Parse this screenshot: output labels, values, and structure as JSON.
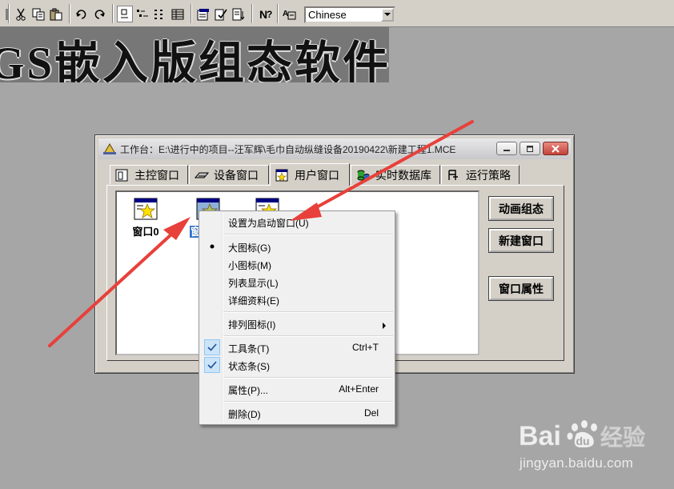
{
  "toolbar": {
    "language": "Chinese"
  },
  "banner": {
    "text": "GS嵌入版组态软件"
  },
  "workbench": {
    "title": "工作台：E:\\进行中的项目--汪军辉\\毛巾自动纵缝设备20190422\\新建工程1.MCE",
    "tabs": [
      {
        "label": "主控窗口",
        "icon": "main-window-icon"
      },
      {
        "label": "设备窗口",
        "icon": "device-icon"
      },
      {
        "label": "用户窗口",
        "icon": "user-window-icon",
        "active": true
      },
      {
        "label": "实时数据库",
        "icon": "database-icon"
      },
      {
        "label": "运行策略",
        "icon": "strategy-icon"
      }
    ],
    "items": [
      {
        "label": "窗口0"
      },
      {
        "label": "窗"
      },
      {
        "label": ""
      }
    ],
    "buttons": {
      "animation": "动画组态",
      "new_window": "新建窗口",
      "properties": "窗口属性"
    }
  },
  "context_menu": {
    "items": [
      {
        "label": "设置为启动窗口(U)",
        "shortcut": ""
      },
      {
        "label": "大图标(G)",
        "shortcut": "",
        "bullet": true
      },
      {
        "label": "小图标(M)",
        "shortcut": ""
      },
      {
        "label": "列表显示(L)",
        "shortcut": ""
      },
      {
        "label": "详细资料(E)",
        "shortcut": ""
      },
      {
        "label": "排列图标(I)",
        "shortcut": "",
        "submenu": true
      },
      {
        "label": "工具条(T)",
        "shortcut": "Ctrl+T",
        "checked": true
      },
      {
        "label": "状态条(S)",
        "shortcut": "",
        "checked": true
      },
      {
        "label": "属性(P)...",
        "shortcut": "Alt+Enter"
      },
      {
        "label": "删除(D)",
        "shortcut": "Del"
      }
    ]
  },
  "watermark": {
    "brand": "Bai",
    "brand2": "经验",
    "url": "jingyan.baidu.com"
  },
  "colors": {
    "desktop": "#a6a6a6",
    "annotation_arrow": "#e8403a",
    "check_highlight": "#cce4f7"
  }
}
